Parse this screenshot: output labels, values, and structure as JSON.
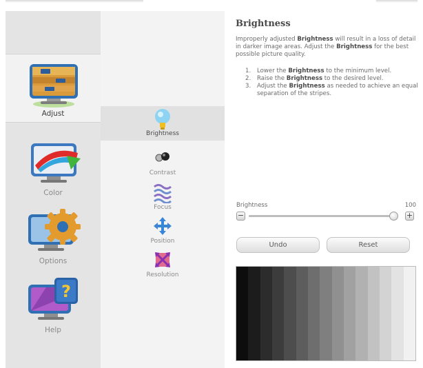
{
  "categories": [
    {
      "id": "adjust",
      "label": "Adjust",
      "selected": true
    },
    {
      "id": "color",
      "label": "Color",
      "selected": false
    },
    {
      "id": "options",
      "label": "Options",
      "selected": false
    },
    {
      "id": "help",
      "label": "Help",
      "selected": false
    }
  ],
  "subitems": [
    {
      "id": "brightness",
      "label": "Brightness",
      "selected": true
    },
    {
      "id": "contrast",
      "label": "Contrast",
      "selected": false
    },
    {
      "id": "focus",
      "label": "Focus",
      "selected": false
    },
    {
      "id": "position",
      "label": "Position",
      "selected": false
    },
    {
      "id": "resolution",
      "label": "Resolution",
      "selected": false
    }
  ],
  "panel": {
    "title": "Brightness",
    "desc_1": "Improperly adjusted ",
    "desc_bold_1": "Brightness",
    "desc_2": " will result in a loss of detail in darker image areas. Adjust the ",
    "desc_bold_2": "Brightness",
    "desc_3": " for the best possible picture quality.",
    "steps": [
      {
        "num": "1.",
        "a": "Lower the ",
        "b": "Brightness",
        "c": " to the minimum level."
      },
      {
        "num": "2.",
        "a": "Raise the ",
        "b": "Brightness",
        "c": " to the desired level."
      },
      {
        "num": "3.",
        "a": "Adjust the ",
        "b": "Brightness",
        "c": " as needed to achieve an equal separation of the stripes."
      }
    ]
  },
  "slider": {
    "label": "Brightness",
    "value": "100",
    "min": 0,
    "max": 100,
    "level": 100,
    "decrease_symbol": "−",
    "increase_symbol": "+"
  },
  "buttons": {
    "undo": "Undo",
    "reset": "Reset"
  },
  "test_pattern": {
    "stripes": [
      "#0d0d0d",
      "#1c1c1c",
      "#2c2c2c",
      "#3c3c3c",
      "#4d4d4d",
      "#5d5d5d",
      "#6e6e6e",
      "#7f7f7f",
      "#909090",
      "#a1a1a1",
      "#b1b1b1",
      "#c2c2c2",
      "#d3d3d3",
      "#e3e3e3",
      "#f1f1f1"
    ]
  },
  "icons": {
    "adjust": "adjust-monitor-icon",
    "color": "color-monitor-icon",
    "options": "options-gear-monitor-icon",
    "help": "help-question-monitor-icon",
    "brightness": "lightbulb-icon",
    "contrast": "contrast-spheres-icon",
    "focus": "focus-waves-icon",
    "position": "position-arrows-icon",
    "resolution": "resolution-arrows-icon"
  }
}
